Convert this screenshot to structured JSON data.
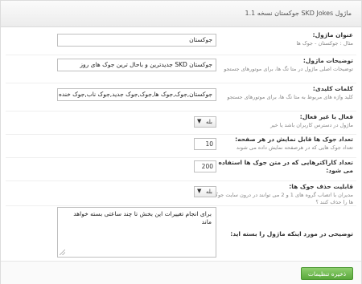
{
  "header": {
    "title": "ماژول SKD Jokes جوکستان نسخه 1.1"
  },
  "fields": {
    "module_title": {
      "label": "عنوان ماژول:",
      "desc": "مثال : جوکستان - جوک ها",
      "value": "جوکستان"
    },
    "module_description": {
      "label": "توضیحات ماژول:",
      "desc": "توضیحات اصلی ماژول در متا تگ ها، برای موتورهای جستجو",
      "value": "جوکستان SKD جدیدترین و باحال ترین جوک های روز"
    },
    "keywords": {
      "label": "کلمات کلیدی:",
      "desc": "کلید واژه های مربوط به متا تگ ها، برای موتورهای جستجو",
      "value": "جوکستان,جوک,جوک ها,جوک,جوک جدید,جوک ناب,جوک خنده دا"
    },
    "active": {
      "label": "فعال یا غیر فعال:",
      "desc": "ماژول در دسترس کاربران باشد یا خیر",
      "value": "بله"
    },
    "jokes_per_page": {
      "label": "تعداد جوک ها قابل نمایش در هر صفحه:",
      "desc": "تعداد جوک هایی که در هرصفحه نمایش داده می شوند",
      "value": "10"
    },
    "max_chars": {
      "label": "تعداد کاراکترهایی که در متن جوک ها استفاده می شود:",
      "value": "200"
    },
    "delete_ability": {
      "label": "قابلیت حذف جوک ها:",
      "desc": "مدیران با اتصاب گروه های 1 و 2 می توانند در درون سایت جوک ها را حذف کنند ؟",
      "value": "بله"
    },
    "closed_message": {
      "label": "توضیحی در مورد اینکه ماژول را بسته اید:",
      "value": "برای انجام تغییرات این بخش تا چند ساعتی بسته خواهد ماند"
    }
  },
  "footer": {
    "save_label": "ذخیره تنظیمات"
  }
}
